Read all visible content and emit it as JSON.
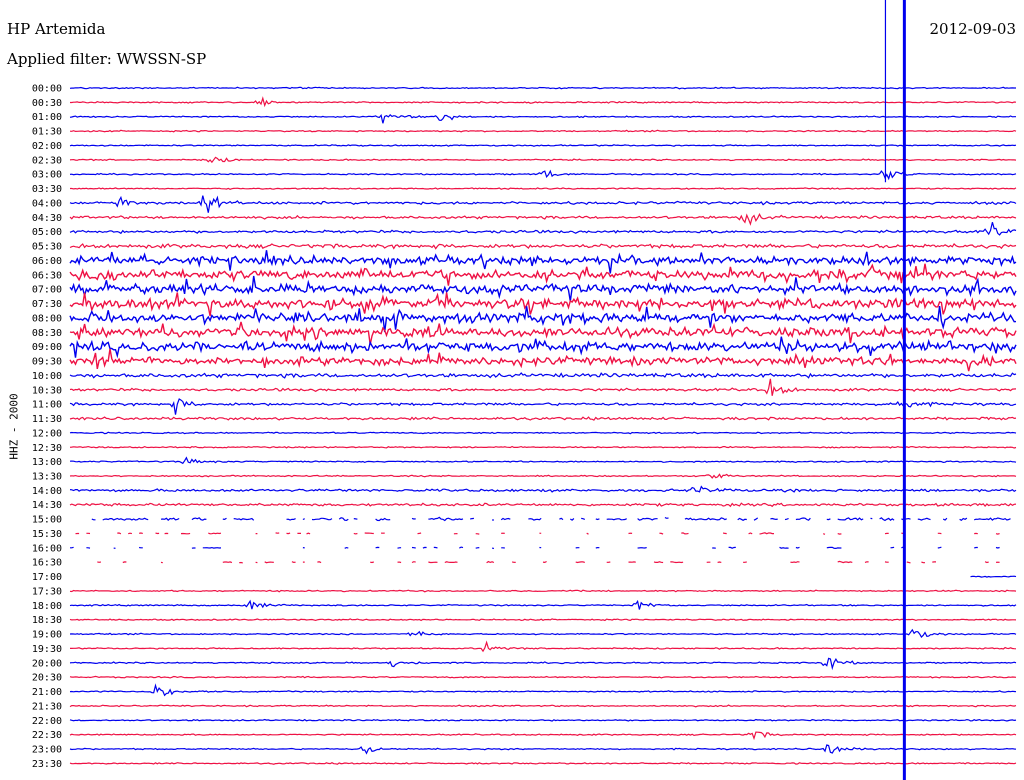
{
  "header": {
    "station": "HP Artemida",
    "date": "2012-09-03",
    "filter_label": "Applied filter: WWSSN-SP",
    "channel_label": "HHZ - 2000"
  },
  "colors": {
    "trace_a": "#0000ee",
    "trace_b": "#ee1144"
  },
  "chart_data": {
    "type": "line",
    "title": "HP Artemida",
    "subtitle": "Applied filter: WWSSN-SP",
    "ylabel": "HHZ - 2000",
    "xlabel": "",
    "row_labels": [
      "00:00",
      "00:30",
      "01:00",
      "01:30",
      "02:00",
      "02:30",
      "03:00",
      "03:30",
      "04:00",
      "04:30",
      "05:00",
      "05:30",
      "06:00",
      "06:30",
      "07:00",
      "07:30",
      "08:00",
      "08:30",
      "09:00",
      "09:30",
      "10:00",
      "10:30",
      "11:00",
      "11:30",
      "12:00",
      "12:30",
      "13:00",
      "13:30",
      "14:00",
      "14:30",
      "15:00",
      "15:30",
      "16:00",
      "16:30",
      "17:00",
      "17:30",
      "18:00",
      "18:30",
      "19:00",
      "19:30",
      "20:00",
      "20:30",
      "21:00",
      "21:30",
      "22:00",
      "22:30",
      "23:00",
      "23:30"
    ],
    "row_minutes": 30,
    "noise_level": [
      1,
      1,
      1,
      1,
      1,
      1,
      1,
      1,
      2,
      2,
      2,
      3,
      6,
      7,
      7,
      7,
      7,
      7,
      7,
      6,
      3,
      2,
      2,
      2,
      1,
      1,
      1,
      1,
      2,
      2,
      2,
      1,
      1,
      1,
      1,
      1,
      1,
      1,
      1,
      1,
      1,
      1,
      1,
      1,
      1,
      1,
      1,
      1
    ],
    "data_gaps": [
      {
        "row": "15:00",
        "type": "intermittent"
      },
      {
        "row": "15:30",
        "type": "intermittent"
      },
      {
        "row": "16:00",
        "type": "intermittent"
      },
      {
        "row": "16:30",
        "type": "intermittent"
      },
      {
        "row": "17:00",
        "start": 0.0,
        "end": 0.95
      }
    ],
    "events": [
      {
        "row": "00:30",
        "pos": 0.2,
        "amp": 3
      },
      {
        "row": "01:00",
        "pos": 0.33,
        "amp": 5
      },
      {
        "row": "01:00",
        "pos": 0.39,
        "amp": 4
      },
      {
        "row": "02:30",
        "pos": 0.15,
        "amp": 3
      },
      {
        "row": "03:00",
        "pos": 0.5,
        "amp": 4
      },
      {
        "row": "03:00",
        "pos": 0.86,
        "amp": 6
      },
      {
        "row": "04:00",
        "pos": 0.05,
        "amp": 5
      },
      {
        "row": "04:00",
        "pos": 0.14,
        "amp": 10
      },
      {
        "row": "04:30",
        "pos": 0.71,
        "amp": 7
      },
      {
        "row": "05:00",
        "pos": 0.97,
        "amp": 6
      },
      {
        "row": "10:30",
        "pos": 0.74,
        "amp": 6
      },
      {
        "row": "11:00",
        "pos": 0.11,
        "amp": 5
      },
      {
        "row": "11:00",
        "pos": 0.87,
        "amp": 8
      },
      {
        "row": "13:00",
        "pos": 0.12,
        "amp": 3
      },
      {
        "row": "13:30",
        "pos": 0.67,
        "amp": 4
      },
      {
        "row": "14:00",
        "pos": 0.66,
        "amp": 5
      },
      {
        "row": "18:00",
        "pos": 0.19,
        "amp": 5
      },
      {
        "row": "18:00",
        "pos": 0.6,
        "amp": 4
      },
      {
        "row": "19:00",
        "pos": 0.36,
        "amp": 3
      },
      {
        "row": "19:00",
        "pos": 0.89,
        "amp": 6
      },
      {
        "row": "19:30",
        "pos": 0.44,
        "amp": 4
      },
      {
        "row": "20:00",
        "pos": 0.34,
        "amp": 3
      },
      {
        "row": "20:00",
        "pos": 0.8,
        "amp": 6
      },
      {
        "row": "21:00",
        "pos": 0.09,
        "amp": 6
      },
      {
        "row": "22:30",
        "pos": 0.72,
        "amp": 4
      },
      {
        "row": "23:00",
        "pos": 0.31,
        "amp": 4
      },
      {
        "row": "23:00",
        "pos": 0.8,
        "amp": 6
      }
    ],
    "saturated_spikes": [
      {
        "pos": 0.862,
        "from_row": "00:00",
        "to_row": "03:00"
      },
      {
        "pos": 0.882,
        "from_row": "00:00",
        "to_row": "23:30"
      }
    ]
  }
}
